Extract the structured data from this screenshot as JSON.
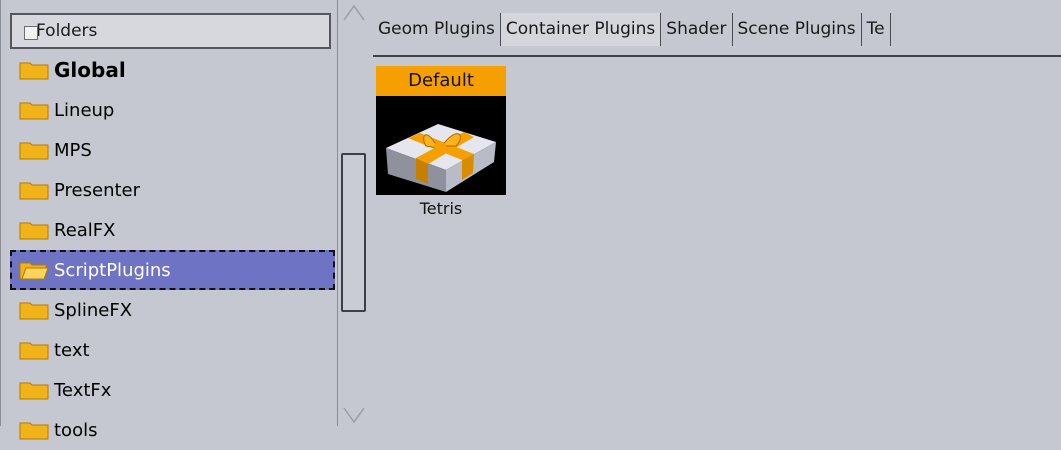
{
  "folders_panel": {
    "header": "Folders",
    "items": [
      {
        "label": "Global",
        "bold": true
      },
      {
        "label": "Lineup"
      },
      {
        "label": "MPS"
      },
      {
        "label": "Presenter"
      },
      {
        "label": "RealFX"
      },
      {
        "label": "ScriptPlugins",
        "selected": true
      },
      {
        "label": "SplineFX"
      },
      {
        "label": "text"
      },
      {
        "label": "TextFx"
      },
      {
        "label": "tools"
      }
    ]
  },
  "tabs": [
    {
      "label": "Geom Plugins"
    },
    {
      "label": "Container Plugins",
      "active": true
    },
    {
      "label": "Shader"
    },
    {
      "label": "Scene Plugins"
    },
    {
      "label": "Te"
    }
  ],
  "plugins": [
    {
      "header": "Default",
      "name": "Tetris",
      "icon": "gift-box-icon"
    }
  ],
  "colors": {
    "background": "#c5c8d0",
    "selection": "#6f73c3",
    "folder": "#f2b21a",
    "tile_header": "#f5a000"
  }
}
